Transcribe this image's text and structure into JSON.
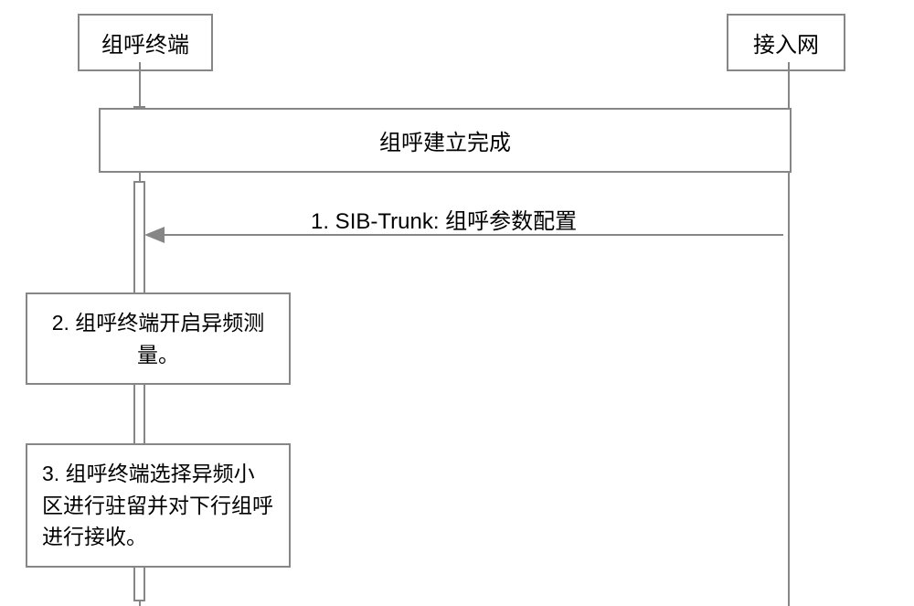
{
  "participants": {
    "left": "组呼终端",
    "right": "接入网"
  },
  "combined": "组呼建立完成",
  "message1": "1. SIB-Trunk: 组呼参数配置",
  "step2": "2. 组呼终端开启异频测量。",
  "step3": "3. 组呼终端选择异频小区进行驻留并对下行组呼进行接收。"
}
